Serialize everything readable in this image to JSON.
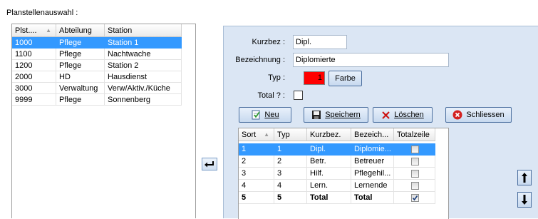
{
  "title_label": "Planstellenauswahl :",
  "left_grid": {
    "columns": [
      "Plst....",
      "Abteilung",
      "Station"
    ],
    "rows": [
      {
        "plst": "1000",
        "abteilung": "Pflege",
        "station": "Station 1",
        "selected": true
      },
      {
        "plst": "1100",
        "abteilung": "Pflege",
        "station": "Nachtwache"
      },
      {
        "plst": "1200",
        "abteilung": "Pflege",
        "station": "Station 2"
      },
      {
        "plst": "2000",
        "abteilung": "HD",
        "station": "Hausdienst"
      },
      {
        "plst": "3000",
        "abteilung": "Verwaltung",
        "station": "Verw/Aktiv./Küche"
      },
      {
        "plst": "9999",
        "abteilung": "Pflege",
        "station": "Sonnenberg"
      }
    ]
  },
  "form": {
    "kurzbez_label": "Kurzbez :",
    "kurzbez_value": "Dipl.",
    "bezeichnung_label": "Bezeichnung :",
    "bezeichnung_value": "Diplomierte",
    "typ_label": "Typ :",
    "typ_value": "1",
    "typ_color": "#ff0000",
    "farbe_label": "Farbe",
    "total_label": "Total ? :"
  },
  "toolbar": {
    "neu_label": "Neu",
    "speichern_label": "Speichern",
    "loeschen_label": "Löschen",
    "schliessen_label": "Schliessen"
  },
  "right_grid": {
    "columns": [
      "Sort",
      "Typ",
      "Kurzbez.",
      "Bezeich...",
      "Totalzeile"
    ],
    "rows": [
      {
        "sort": "1",
        "typ": "1",
        "kurzbez": "Dipl.",
        "bezeich": "Diplomie...",
        "total": false,
        "selected": true
      },
      {
        "sort": "2",
        "typ": "2",
        "kurzbez": "Betr.",
        "bezeich": "Betreuer",
        "total": false
      },
      {
        "sort": "3",
        "typ": "3",
        "kurzbez": "Hilf.",
        "bezeich": "Pflegehil...",
        "total": false
      },
      {
        "sort": "4",
        "typ": "4",
        "kurzbez": "Lern.",
        "bezeich": "Lernende",
        "total": false
      },
      {
        "sort": "5",
        "typ": "5",
        "kurzbez": "Total",
        "bezeich": "Total",
        "total": true,
        "bold": true
      }
    ]
  },
  "colors": {
    "selection": "#3399ff",
    "panel_background": "#dbe6f4",
    "delete_icon": "#cc1111",
    "close_icon": "#d32020"
  }
}
